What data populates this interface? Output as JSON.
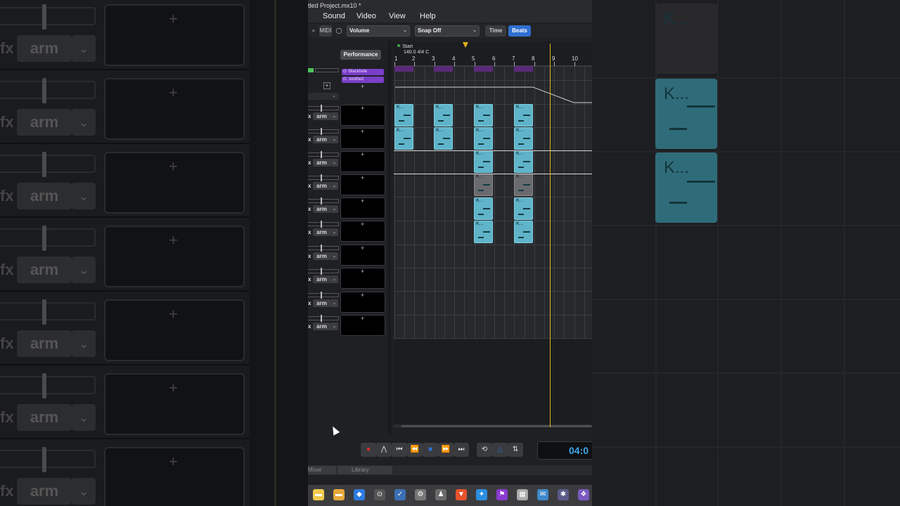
{
  "window": {
    "title": "tled Project.mx10 *"
  },
  "menu": [
    "Sound",
    "Video",
    "View",
    "Help"
  ],
  "toolbar": {
    "midi_label": "MIDI",
    "automation_param": "Volume",
    "snap": "Snap Off",
    "time_label": "Time",
    "beats_label": "Beats"
  },
  "tracks_header": {
    "performance_label": "Performance"
  },
  "master": {
    "plugins": [
      "Blackhole",
      "soothe2"
    ]
  },
  "track_controls": {
    "fx_label": "x",
    "arm_label": "arm"
  },
  "ruler": {
    "start_label": "Start",
    "tempo": "140.0 4/4 C",
    "bars": [
      "1",
      "2",
      "3",
      "4",
      "5",
      "6",
      "7",
      "8",
      "9",
      "10"
    ]
  },
  "clip_label": "K...",
  "transport": {
    "time_readout": "04:0"
  },
  "tabs": [
    "Mixer",
    "Library"
  ],
  "background": {
    "fx_label": "fx",
    "arm_label": "arm",
    "clip_label": "K..."
  },
  "colors": {
    "clip": "#5fb4c9",
    "playhead": "#e0b21a",
    "plugin": "#7a3fc9",
    "beats_active": "#2f6fd0",
    "time": "#3fa7e6"
  }
}
